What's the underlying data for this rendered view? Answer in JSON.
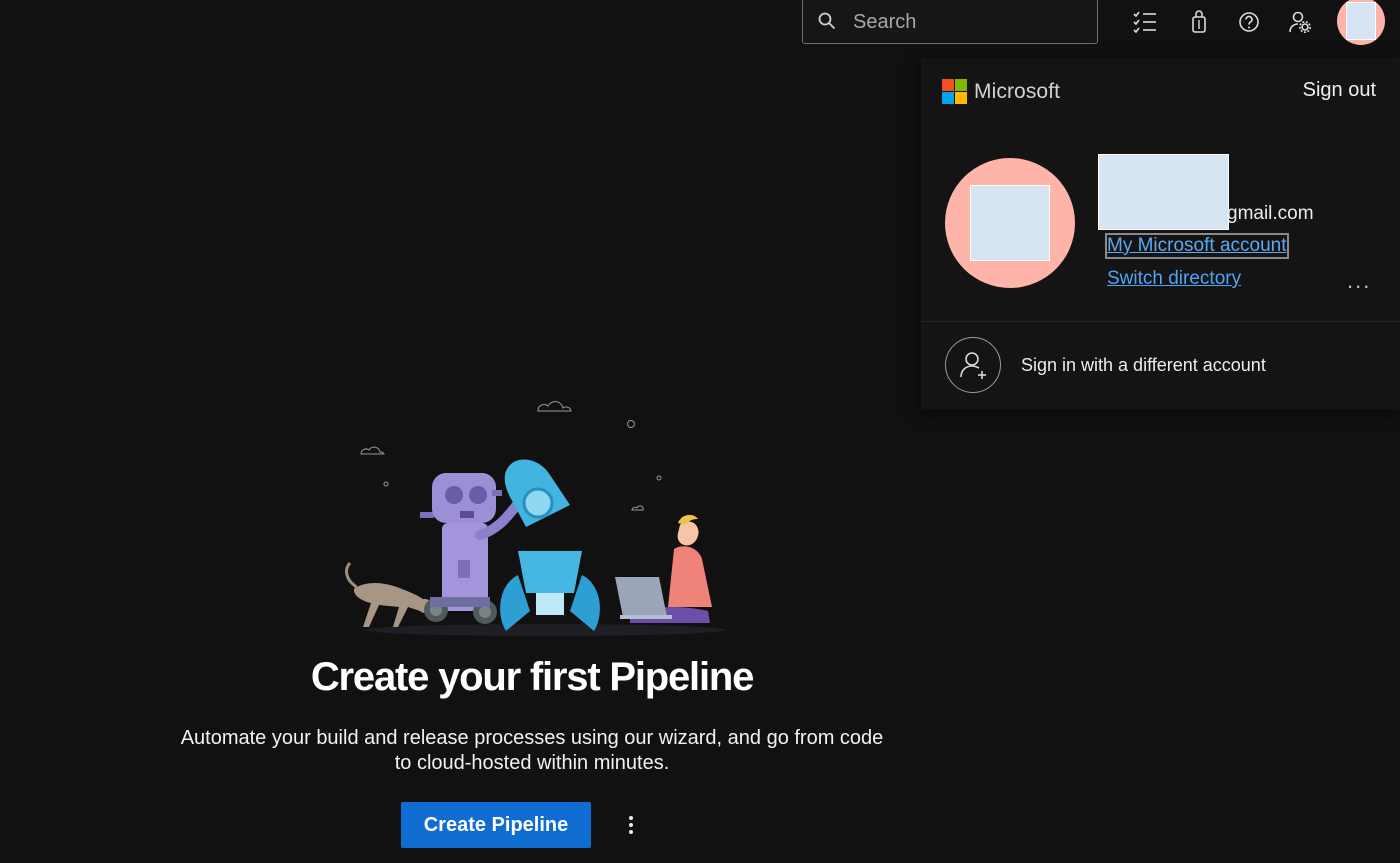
{
  "topbar": {
    "search": {
      "placeholder": "Search",
      "value": ""
    },
    "icons": [
      "task-list-icon",
      "shopping-bag-icon",
      "help-icon",
      "user-settings-icon"
    ]
  },
  "account_flyout": {
    "brand": "Microsoft",
    "sign_out_label": "Sign out",
    "email_suffix": "gmail.com",
    "my_account_link": "My Microsoft account",
    "switch_directory_link": "Switch directory",
    "more_label": "...",
    "different_account_label": "Sign in with a different account",
    "colors": {
      "avatar_bg": "#ffb4a9",
      "link": "#4ea4f5",
      "ms_red": "#f25022",
      "ms_green": "#7fba00",
      "ms_blue": "#00a4ef",
      "ms_yellow": "#ffb900"
    }
  },
  "empty_state": {
    "title": "Create your first Pipeline",
    "description": "Automate your build and release processes using our wizard, and go from code to cloud-hosted within minutes.",
    "primary_button": "Create Pipeline",
    "colors": {
      "primary": "#0f6cd0"
    }
  }
}
